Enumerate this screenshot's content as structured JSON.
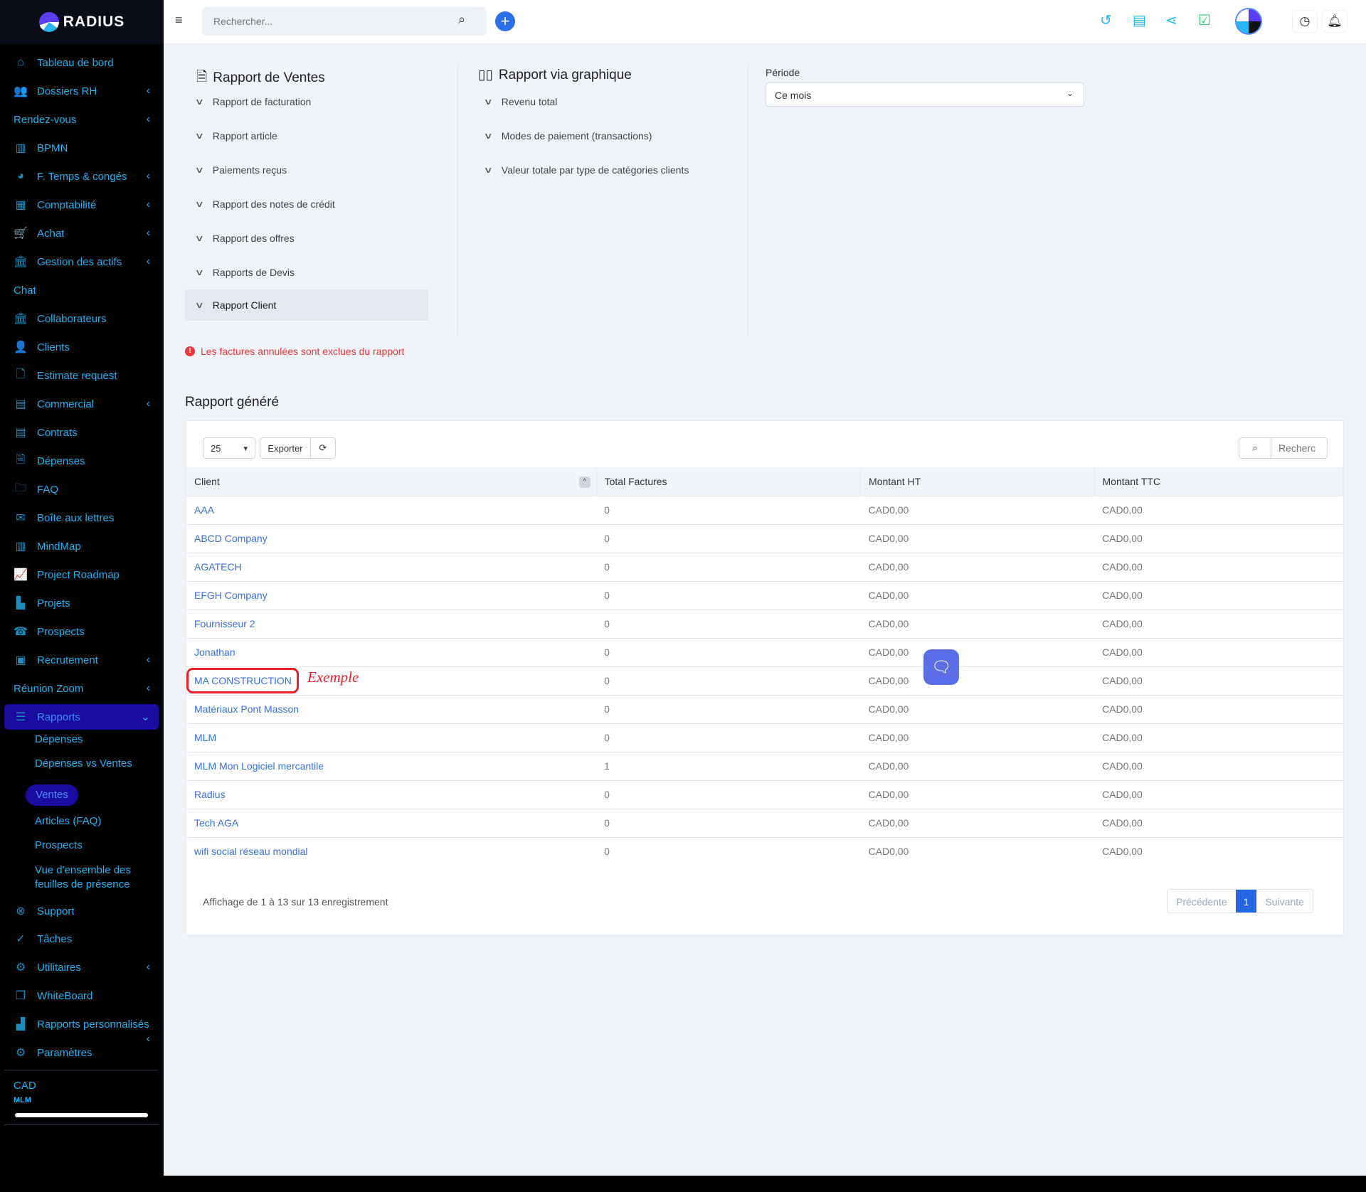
{
  "brand": {
    "name": "RADIUS"
  },
  "sidebar": {
    "items": [
      {
        "label": "Tableau de bord",
        "icon": "home-icon",
        "g": "⌂",
        "chev": false
      },
      {
        "label": "Dossiers RH",
        "icon": "users-icon",
        "g": "👥",
        "chev": true
      },
      {
        "label": "Rendez-vous",
        "icon": "",
        "g": "",
        "chev": true
      },
      {
        "label": "BPMN",
        "icon": "map-icon",
        "g": "▥",
        "chev": false
      },
      {
        "label": "F. Temps & congés",
        "icon": "user-clock-icon",
        "g": "◕",
        "chev": true
      },
      {
        "label": "Comptabilité",
        "icon": "calculator-icon",
        "g": "▦",
        "chev": true
      },
      {
        "label": "Achat",
        "icon": "cart-icon",
        "g": "🛒",
        "chev": true
      },
      {
        "label": "Gestion des actifs",
        "icon": "bank-icon",
        "g": "🏛",
        "chev": true
      },
      {
        "label": "Chat",
        "icon": "",
        "g": "",
        "chev": false
      },
      {
        "label": "Collaborateurs",
        "icon": "bank-icon",
        "g": "🏛",
        "chev": false
      },
      {
        "label": "Clients",
        "icon": "user-icon",
        "g": "👤",
        "chev": false
      },
      {
        "label": "Estimate request",
        "icon": "file-icon",
        "g": "🗋",
        "chev": false
      },
      {
        "label": "Commercial",
        "icon": "document-icon",
        "g": "▤",
        "chev": true
      },
      {
        "label": "Contrats",
        "icon": "contract-icon",
        "g": "▤",
        "chev": false
      },
      {
        "label": "Dépenses",
        "icon": "receipt-icon",
        "g": "🗎",
        "chev": false
      },
      {
        "label": "FAQ",
        "icon": "folder-icon",
        "g": "🗀",
        "chev": false
      },
      {
        "label": "Boîte aux lettres",
        "icon": "mailbox-icon",
        "g": "✉",
        "chev": false
      },
      {
        "label": "MindMap",
        "icon": "map-icon",
        "g": "▥",
        "chev": false
      },
      {
        "label": "Project Roadmap",
        "icon": "line-chart-icon",
        "g": "📈",
        "chev": false
      },
      {
        "label": "Projets",
        "icon": "gantt-icon",
        "g": "▙",
        "chev": false
      },
      {
        "label": "Prospects",
        "icon": "phone-icon",
        "g": "☎",
        "chev": false
      },
      {
        "label": "Recrutement",
        "icon": "id-badge-icon",
        "g": "▣",
        "chev": true
      },
      {
        "label": "Réunion Zoom",
        "icon": "",
        "g": "",
        "chev": true
      },
      {
        "label": "Rapports",
        "icon": "bar-chart-icon",
        "g": "☰",
        "chev": true,
        "active": true
      }
    ],
    "subitems": [
      "Dépenses",
      "Dépenses vs Ventes",
      "Ventes",
      "Articles (FAQ)",
      "Prospects",
      "Vue d'ensemble des feuilles de présence"
    ],
    "active_sub": "Ventes",
    "items2": [
      {
        "label": "Support",
        "icon": "lifebuoy-icon",
        "g": "⊗",
        "chev": false
      },
      {
        "label": "Tâches",
        "icon": "check-circle-icon",
        "g": "✓",
        "chev": false
      },
      {
        "label": "Utilitaires",
        "icon": "cogs-icon",
        "g": "⚙",
        "chev": true
      },
      {
        "label": "WhiteBoard",
        "icon": "copy-icon",
        "g": "❐",
        "chev": false
      },
      {
        "label": "Rapports personnalisés",
        "icon": "area-chart-icon",
        "g": "▟",
        "chev": true
      },
      {
        "label": "Paramètres",
        "icon": "gear-icon",
        "g": "⚙",
        "chev": false
      }
    ],
    "currency": "CAD",
    "company": "MLM"
  },
  "topbar": {
    "search_placeholder": "Rechercher..."
  },
  "sales_report": {
    "title": "Rapport de Ventes",
    "items": [
      "Rapport de facturation",
      "Rapport article",
      "Paiements reçus",
      "Rapport des notes de crédit",
      "Rapport des offres",
      "Rapports de Devis",
      "Rapport Client"
    ],
    "selected": "Rapport Client"
  },
  "chart_report": {
    "title": "Rapport via graphique",
    "items": [
      "Revenu total",
      "Modes de paiement (transactions)",
      "Valeur totale par type de catégories clients"
    ]
  },
  "period": {
    "label": "Période",
    "value": "Ce mois"
  },
  "warning": "Les factures annulées sont exclues du rapport",
  "generated": {
    "title": "Rapport généré",
    "page_size": "25",
    "export": "Exporter",
    "search_placeholder": "Recherc",
    "columns": [
      "Client",
      "Total Factures",
      "Montant HT",
      "Montant TTC"
    ],
    "rows": [
      [
        "AAA",
        "0",
        "CAD0,00",
        "CAD0,00"
      ],
      [
        "ABCD Company",
        "0",
        "CAD0,00",
        "CAD0,00"
      ],
      [
        "AGATECH",
        "0",
        "CAD0,00",
        "CAD0,00"
      ],
      [
        "EFGH Company",
        "0",
        "CAD0,00",
        "CAD0,00"
      ],
      [
        "Fournisseur 2",
        "0",
        "CAD0,00",
        "CAD0,00"
      ],
      [
        "Jonathan",
        "0",
        "CAD0,00",
        "CAD0,00"
      ],
      [
        "MA CONSTRUCTION",
        "0",
        "CAD0,00",
        "CAD0,00"
      ],
      [
        "Matériaux Pont Masson",
        "0",
        "CAD0,00",
        "CAD0,00"
      ],
      [
        "MLM",
        "0",
        "CAD0,00",
        "CAD0,00"
      ],
      [
        "MLM Mon Logiciel mercantile",
        "1",
        "CAD0,00",
        "CAD0,00"
      ],
      [
        "Radius",
        "0",
        "CAD0,00",
        "CAD0,00"
      ],
      [
        "Tech AGA",
        "0",
        "CAD0,00",
        "CAD0,00"
      ],
      [
        "wifi social réseau mondial",
        "0",
        "CAD0,00",
        "CAD0,00"
      ]
    ],
    "info": "Affichage de 1 à 13 sur 13 enregistrement",
    "pagination": {
      "prev": "Précédente",
      "current": "1",
      "next": "Suivante"
    }
  },
  "annotation": {
    "text": "Exemple",
    "color": "#e8202a"
  }
}
